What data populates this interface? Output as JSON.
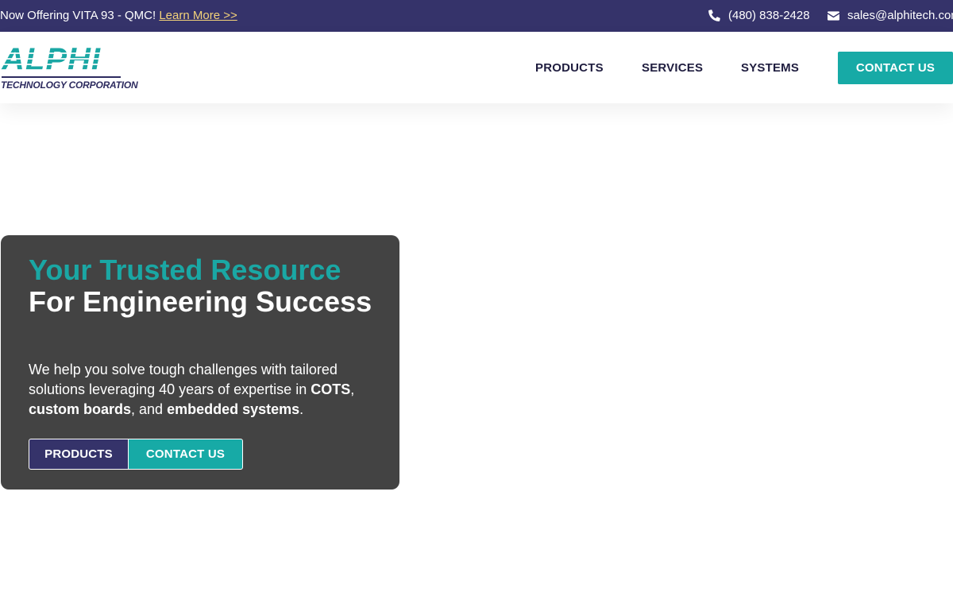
{
  "topbar": {
    "announcement": "Now Offering VITA 93 - QMC!",
    "learn_more": "Learn More >>",
    "phone": "(480) 838-2428",
    "email": "sales@alphitech.com",
    "phone_icon": "phone-icon",
    "email_icon": "envelope-icon",
    "background": "#35336a",
    "link_color": "#f3d27a"
  },
  "logo": {
    "word": "ALPHI",
    "subtitle": "TECHNOLOGY CORPORATION"
  },
  "nav": {
    "items": [
      "PRODUCTS",
      "SERVICES",
      "SYSTEMS"
    ],
    "contact_button": "CONTACT US"
  },
  "hero": {
    "title_accent": "Your Trusted Resource",
    "title_rest": "For Engineering Success",
    "desc_part1": "We help you solve tough challenges with tailored solutions leveraging 40 years of expertise in ",
    "desc_bold1": "COTS",
    "desc_part2": ", ",
    "desc_bold2": "custom boards",
    "desc_part3": ", and ",
    "desc_bold3": "embedded systems",
    "desc_part4": ".",
    "btn_products": "PRODUCTS",
    "btn_contact": "CONTACT US"
  },
  "colors": {
    "teal": "#17aaa6",
    "navy": "#35336a",
    "card": "#434343"
  }
}
